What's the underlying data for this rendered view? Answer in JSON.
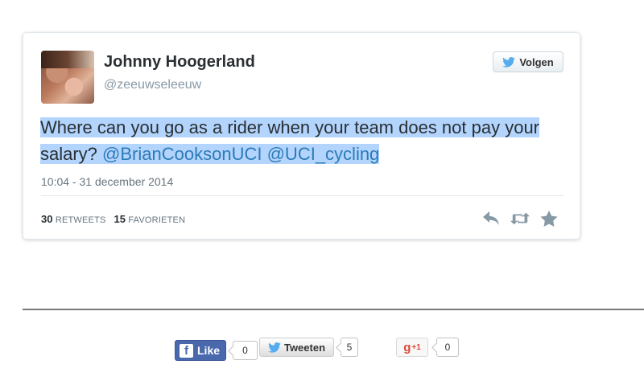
{
  "tweet": {
    "author_name": "Johnny Hoogerland",
    "handle": "@zeeuwseleeuw",
    "follow_label": "Volgen",
    "text_plain": "Where can you go as a rider when your team does not pay your salary? ",
    "mention_1": "@BrianCooksonUCI",
    "mention_2": "@UCI_cycling",
    "timestamp": "10:04 - 31 december 2014",
    "retweets_count": "30",
    "retweets_label": "RETWEETS",
    "favorites_count": "15",
    "favorites_label": "FAVORIETEN",
    "actions": [
      "reply-icon",
      "retweet-icon",
      "favorite-icon"
    ]
  },
  "share": {
    "facebook_label": "Like",
    "facebook_logo": "f",
    "facebook_count": "0",
    "twitter_label": "Tweeten",
    "twitter_count": "5",
    "gplus_label": "g",
    "gplus_suffix": "+1",
    "gplus_count": "0"
  },
  "colors": {
    "selection": "#b3d4fc",
    "mention": "#2b7bb9",
    "twitter_blue": "#55acee",
    "facebook": "#4a69ad",
    "gplus": "#dd4b39"
  }
}
